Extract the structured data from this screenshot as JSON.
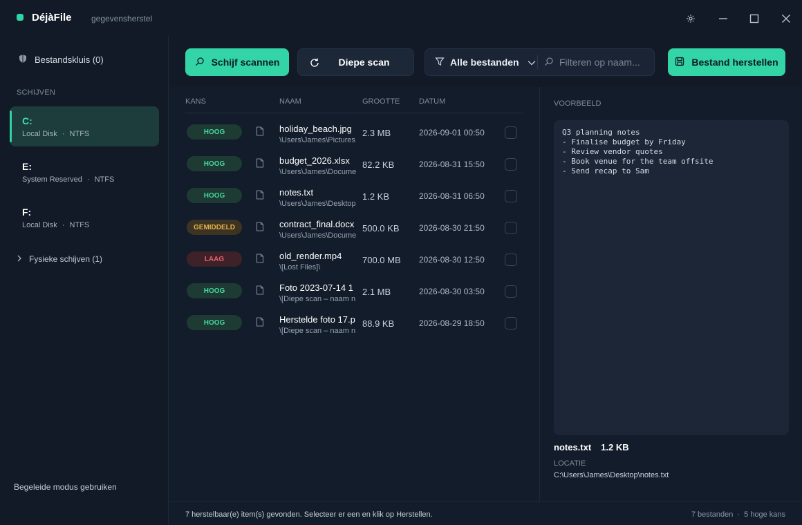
{
  "app": {
    "name": "DéjàFile",
    "subtitle": "gegevensherstel",
    "accent": "#33d4a6"
  },
  "window_controls": {
    "settings_icon": "gear-icon",
    "minimize_icon": "minimize-icon",
    "maximize_icon": "maximize-icon",
    "close_icon": "close-icon"
  },
  "sidebar": {
    "vault_label": "Bestandskluis (0)",
    "drives_label": "SCHIJVEN",
    "drives": [
      {
        "letter": "C:",
        "name": "Local Disk",
        "fs": "NTFS",
        "active": true
      },
      {
        "letter": "E:",
        "name": "System Reserved",
        "fs": "NTFS",
        "active": false
      },
      {
        "letter": "F:",
        "name": "Local Disk",
        "fs": "NTFS",
        "active": false
      }
    ],
    "meta_separator": "·",
    "physical_label": "Fysieke schijven (1)",
    "guided_label": "Begeleide modus gebruiken"
  },
  "toolbar": {
    "scan_label": "Schijf scannen",
    "deep_scan_label": "Diepe scan",
    "filter_type_label": "Alle bestanden",
    "search_placeholder": "Filteren op naam...",
    "recover_label": "Bestand herstellen"
  },
  "table": {
    "headers": {
      "chance": "KANS",
      "name": "NAAM",
      "size": "GROOTTE",
      "date": "DATUM"
    },
    "rows": [
      {
        "chance": "HOOG",
        "level": "hoog",
        "name": "holiday_beach.jpg",
        "path": "\\Users\\James\\Pictures",
        "size": "2.3 MB",
        "date": "2026-09-01 00:50"
      },
      {
        "chance": "HOOG",
        "level": "hoog",
        "name": "budget_2026.xlsx",
        "path": "\\Users\\James\\Documents",
        "size": "82.2 KB",
        "date": "2026-08-31 15:50"
      },
      {
        "chance": "HOOG",
        "level": "hoog",
        "name": "notes.txt",
        "path": "\\Users\\James\\Desktop",
        "size": "1.2 KB",
        "date": "2026-08-31 06:50"
      },
      {
        "chance": "GEMIDDELD",
        "level": "mid",
        "name": "contract_final.docx",
        "path": "\\Users\\James\\Documents",
        "size": "500.0 KB",
        "date": "2026-08-30 21:50"
      },
      {
        "chance": "LAAG",
        "level": "laag",
        "name": "old_render.mp4",
        "path": "\\[Lost Files]\\",
        "size": "700.0 MB",
        "date": "2026-08-30 12:50"
      },
      {
        "chance": "HOOG",
        "level": "hoog",
        "name": "Foto 2023-07-14 1",
        "path": "\\[Diepe scan – naam n",
        "size": "2.1 MB",
        "date": "2026-08-30 03:50"
      },
      {
        "chance": "HOOG",
        "level": "hoog",
        "name": "Herstelde foto 17.p",
        "path": "\\[Diepe scan – naam n",
        "size": "88.9 KB",
        "date": "2026-08-29 18:50"
      }
    ]
  },
  "preview": {
    "label": "VOORBEELD",
    "lines": [
      "Q3 planning notes",
      "- Finalise budget by Friday",
      "- Review vendor quotes",
      "- Book venue for the team offsite",
      "- Send recap to Sam"
    ],
    "file_name": "notes.txt",
    "file_size": "1.2 KB",
    "location_label": "LOCATIE",
    "location": "C:\\Users\\James\\Desktop\\notes.txt"
  },
  "status": {
    "message": "7 herstelbaar(e) item(s) gevonden. Selecteer er een en klik op Herstellen.",
    "count": "7 bestanden",
    "separator": "·",
    "high_chance": "5 hoge kans"
  }
}
